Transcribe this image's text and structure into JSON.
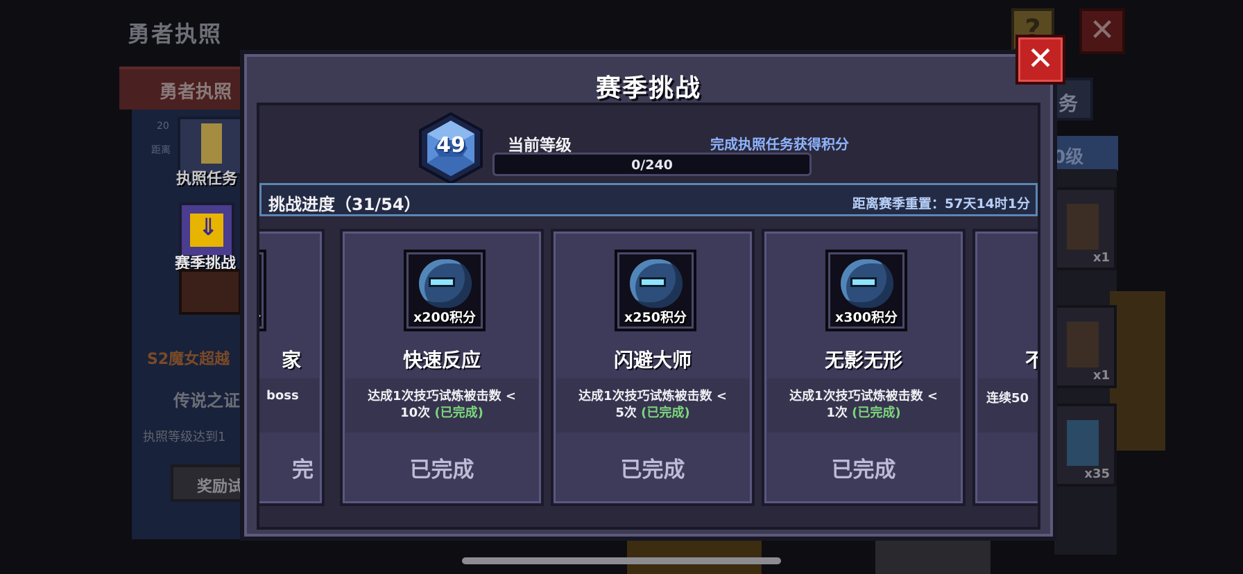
{
  "background": {
    "title": "勇者执照",
    "help_glyph": "?",
    "close_glyph": "✕",
    "banner_label": "勇者执照",
    "small_text_1": "20",
    "small_text_2": "距离",
    "nav_task_label": "执照任务",
    "nav_season_label": "赛季挑战",
    "season_name": "S2魔女超越",
    "legend_label": "传说之证",
    "requirement_text": "执照等级达到1",
    "reward_button": "奖励试",
    "right_tab": "务",
    "right_level": "0级",
    "right_slots": [
      {
        "qty": "x1"
      },
      {
        "qty": "x1"
      },
      {
        "qty": "x35"
      }
    ]
  },
  "modal": {
    "title": "赛季挑战",
    "level": "49",
    "current_level_label": "当前等级",
    "earn_hint": "完成执照任务获得积分",
    "xp_text": "0/240",
    "xp_fraction": 0,
    "progress_label": "挑战进度（31/54）",
    "reset_label": "距离赛季重置：57天14时1分",
    "close_glyph": "✕"
  },
  "cards": {
    "partial_left": {
      "title": "家",
      "desc": "boss",
      "reward_glyph": "分",
      "button": "完"
    },
    "items": [
      {
        "reward": "x200积分",
        "title": "快速反应",
        "desc_line1": "达成1次技巧试炼被击数 <",
        "desc_line2": "10次",
        "status_tag": "(已完成)",
        "button": "已完成"
      },
      {
        "reward": "x250积分",
        "title": "闪避大师",
        "desc_line1": "达成1次技巧试炼被击数 <",
        "desc_line2": "5次",
        "status_tag": "(已完成)",
        "button": "已完成"
      },
      {
        "reward": "x300积分",
        "title": "无影无形",
        "desc_line1": "达成1次技巧试炼被击数 <",
        "desc_line2": "1次",
        "status_tag": "(已完成)",
        "button": "已完成"
      }
    ],
    "partial_right": {
      "title": "不",
      "desc": "连续50"
    }
  }
}
